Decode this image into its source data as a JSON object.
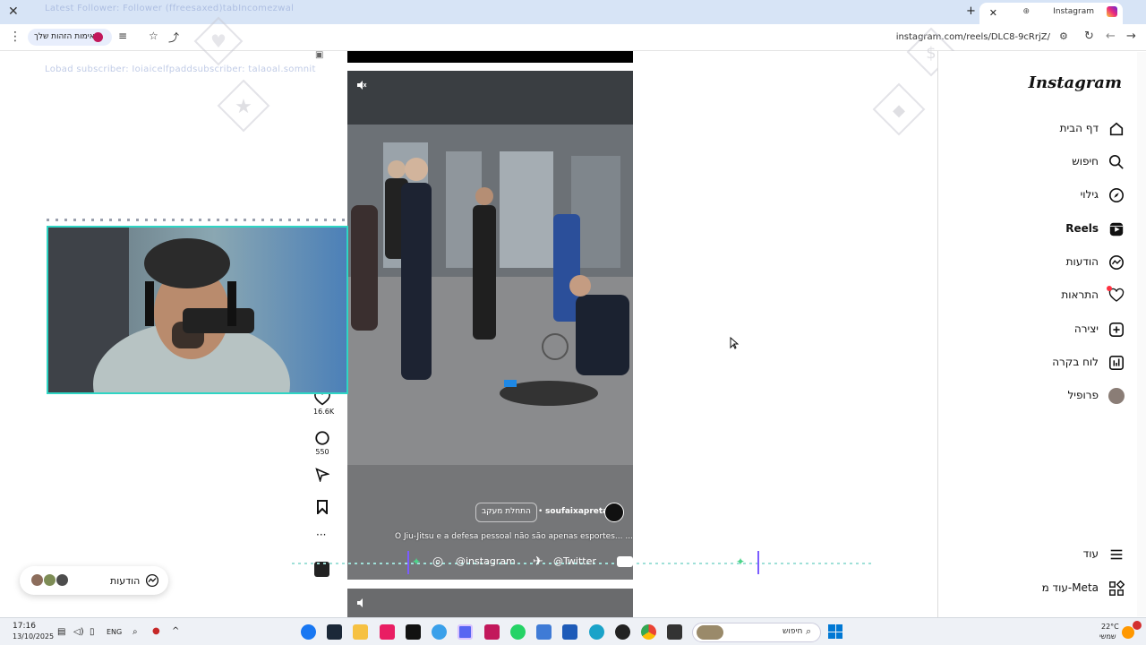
{
  "browser": {
    "tab_title": "Instagram",
    "url": "instagram.com/reels/DLC8-9cRrjZ/",
    "extension_label": "אימות הזהות שלך",
    "stream_overlay_text": "Latest Follower: Follower (ffreesaxed)tabIncomezwal",
    "stream_overlay_text_2": "Lobad subscriber: Ioiaicelfpaddsubscriber: talaoal.somnit"
  },
  "instagram": {
    "logo": "Instagram",
    "nav": [
      {
        "label": "דף הבית",
        "icon": "home-icon"
      },
      {
        "label": "חיפוש",
        "icon": "search-icon"
      },
      {
        "label": "גילוי",
        "icon": "compass-icon"
      },
      {
        "label": "Reels",
        "icon": "reels-icon",
        "active": true
      },
      {
        "label": "הודעות",
        "icon": "messenger-icon"
      },
      {
        "label": "התראות",
        "icon": "heart-icon",
        "badge": true
      },
      {
        "label": "יצירה",
        "icon": "plus-square-icon"
      },
      {
        "label": "לוח בקרה",
        "icon": "dashboard-icon"
      },
      {
        "label": "פרופיל",
        "icon": "profile-avatar"
      }
    ],
    "more_label": "עוד",
    "meta_label": "עוד מ-Meta",
    "reel": {
      "author": "soufaixapreta",
      "follow_label": "התחלת מעקב",
      "caption": "O Jiu-Jitsu e a defesa pessoal não são apenas esportes... ... עוד",
      "likes": "16.6K",
      "comments": "550"
    },
    "messages_label": "הודעות"
  },
  "social_banner": {
    "instagram": "@instagram",
    "twitter": "@Twitter"
  },
  "taskbar": {
    "time": "17:16",
    "date": "13/10/2025",
    "lang": "ENG",
    "search_placeholder": "חיפוש",
    "weather_temp": "22°C",
    "weather_desc": "שמשי"
  }
}
